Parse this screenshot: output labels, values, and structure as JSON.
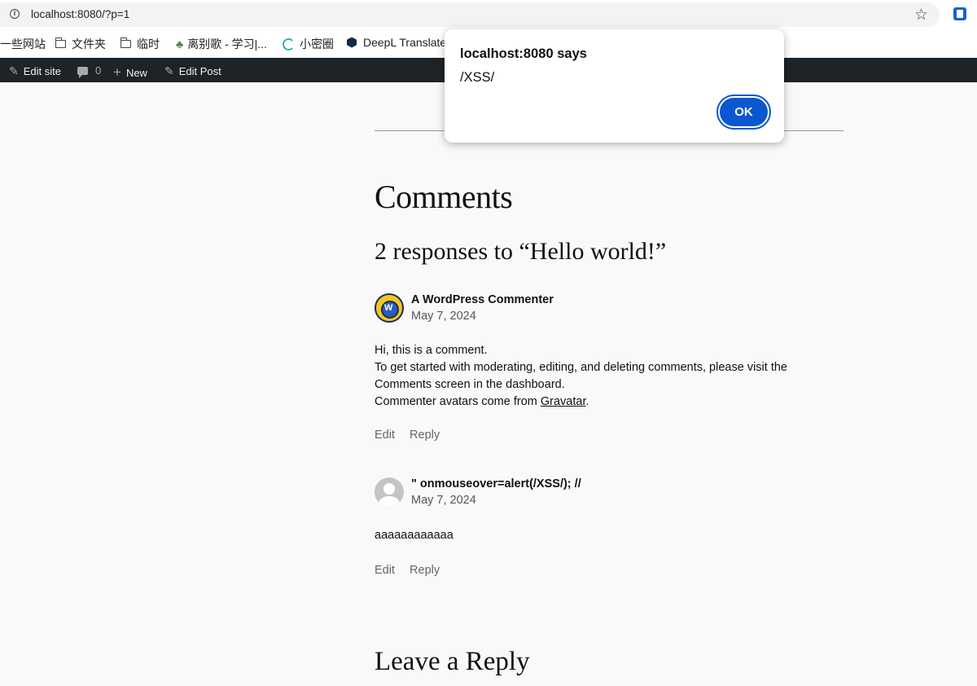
{
  "browser": {
    "url": "localhost:8080/?p=1",
    "bookmarks": [
      "一些网站",
      "文件夹",
      "临时",
      "离别歌 - 学习|...",
      "小密圈",
      "DeepL Translate"
    ]
  },
  "adminbar": {
    "edit_site": "Edit site",
    "comments_count": "0",
    "new_label": "New",
    "edit_post": "Edit Post"
  },
  "content": {
    "comments_heading": "Comments",
    "responses_heading": "2 responses to “Hello world!”",
    "comments": [
      {
        "author": "A WordPress Commenter",
        "date": "May 7, 2024",
        "lines": [
          "Hi, this is a comment.",
          "To get started with moderating, editing, and deleting comments, please visit the Comments screen in the dashboard.",
          "Commenter avatars come from "
        ],
        "link_text": "Gravatar",
        "after_link": ".",
        "edit": "Edit",
        "reply": "Reply"
      },
      {
        "author": "\" onmouseover=alert(/XSS/); //",
        "date": "May 7, 2024",
        "text": "aaaaaaaaaaaa",
        "edit": "Edit",
        "reply": "Reply"
      }
    ],
    "leave_reply": "Leave a Reply"
  },
  "dialog": {
    "title": "localhost:8080 says",
    "message": "/XSS/",
    "ok": "OK"
  }
}
